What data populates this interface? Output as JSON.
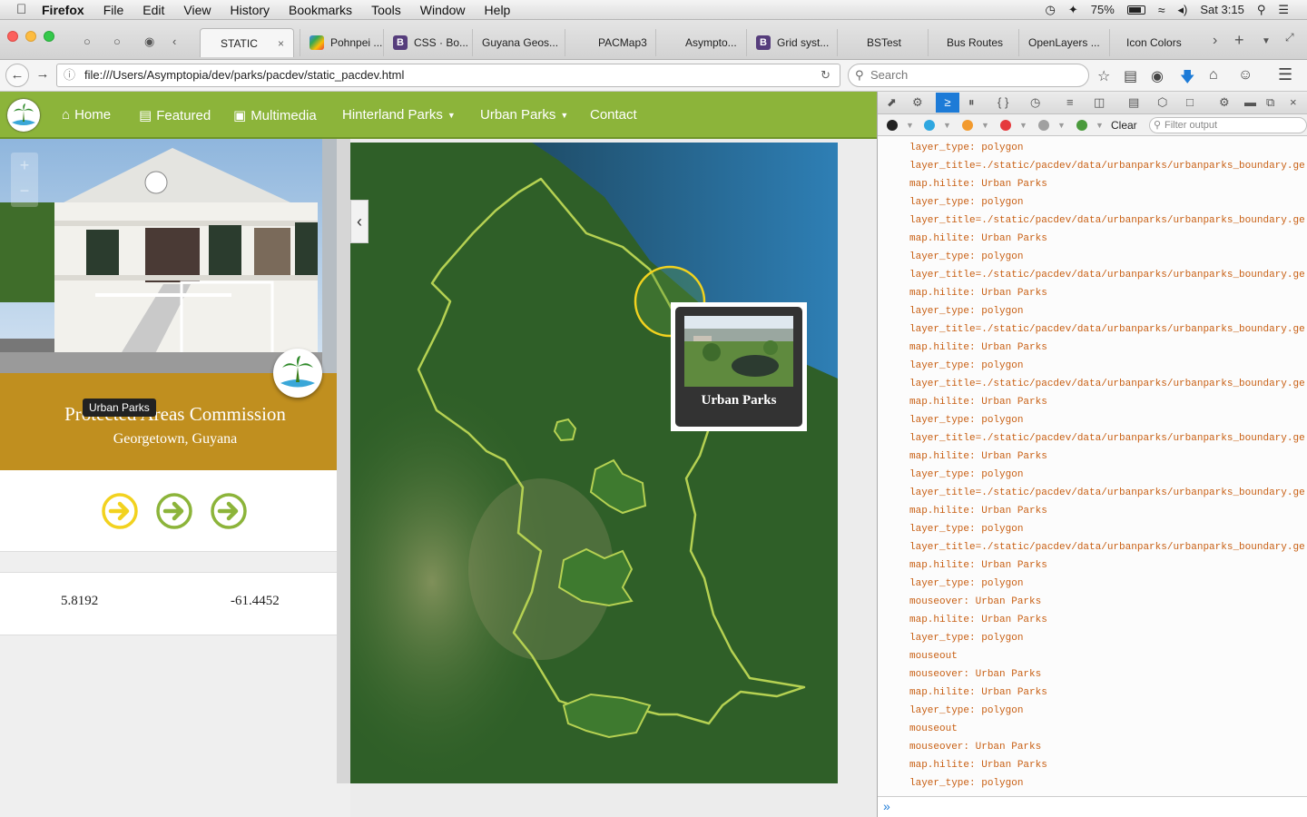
{
  "menubar": {
    "app": "Firefox",
    "items": [
      "File",
      "Edit",
      "View",
      "History",
      "Bookmarks",
      "Tools",
      "Window",
      "Help"
    ],
    "battery": "75%",
    "clock": "Sat 3:15"
  },
  "tabs": [
    {
      "label": "STATIC",
      "active": true
    },
    {
      "label": "Pohnpei ...",
      "icon": "maps-icon"
    },
    {
      "label": "CSS · Bo...",
      "icon": "bootstrap-icon"
    },
    {
      "label": "Guyana Geos...",
      "icon": ""
    },
    {
      "label": "PACMap3",
      "icon": ""
    },
    {
      "label": "Asympto...",
      "icon": ""
    },
    {
      "label": "Grid syst...",
      "icon": "bootstrap-icon"
    },
    {
      "label": "BSTest",
      "icon": ""
    },
    {
      "label": "Bus Routes",
      "icon": ""
    },
    {
      "label": "OpenLayers ...",
      "icon": ""
    },
    {
      "label": "Icon Colors",
      "icon": ""
    }
  ],
  "url": "file:///Users/Asymptopia/dev/parks/pacdev/static_pacdev.html",
  "search_placeholder": "Search",
  "site_nav": {
    "home": "Home",
    "featured": "Featured",
    "multimedia": "Multimedia",
    "hinterland": "Hinterland Parks",
    "urban": "Urban Parks",
    "contact": "Contact"
  },
  "sidebar": {
    "title": "Protected Areas Commission",
    "subtitle": "Georgetown, Guyana",
    "tooltip": "Urban Parks",
    "lat": "5.8192",
    "lon": "-61.4452",
    "arrow_colors": [
      "#f2d21f",
      "#8cb43a",
      "#8cb43a"
    ]
  },
  "map": {
    "popup_label": "Urban Parks",
    "highlight_color": "#f2d21f",
    "boundary_color": "#b5d152"
  },
  "devtools": {
    "clear": "Clear",
    "filter_placeholder": "Filter output",
    "log": [
      "layer_type: polygon",
      "layer_title=./static/pacdev/data/urbanparks/urbanparks_boundary.ge",
      "map.hilite: Urban Parks",
      "layer_type: polygon",
      "layer_title=./static/pacdev/data/urbanparks/urbanparks_boundary.ge",
      "map.hilite: Urban Parks",
      "layer_type: polygon",
      "layer_title=./static/pacdev/data/urbanparks/urbanparks_boundary.ge",
      "map.hilite: Urban Parks",
      "layer_type: polygon",
      "layer_title=./static/pacdev/data/urbanparks/urbanparks_boundary.ge",
      "map.hilite: Urban Parks",
      "layer_type: polygon",
      "layer_title=./static/pacdev/data/urbanparks/urbanparks_boundary.ge",
      "map.hilite: Urban Parks",
      "layer_type: polygon",
      "layer_title=./static/pacdev/data/urbanparks/urbanparks_boundary.ge",
      "map.hilite: Urban Parks",
      "layer_type: polygon",
      "layer_title=./static/pacdev/data/urbanparks/urbanparks_boundary.ge",
      "map.hilite: Urban Parks",
      "layer_type: polygon",
      "layer_title=./static/pacdev/data/urbanparks/urbanparks_boundary.ge",
      "map.hilite: Urban Parks",
      "layer_type: polygon",
      "mouseover: Urban Parks",
      "map.hilite: Urban Parks",
      "layer_type: polygon",
      "mouseout",
      "mouseover: Urban Parks",
      "map.hilite: Urban Parks",
      "layer_type: polygon",
      "mouseout",
      "mouseover: Urban Parks",
      "map.hilite: Urban Parks",
      "layer_type: polygon"
    ]
  }
}
